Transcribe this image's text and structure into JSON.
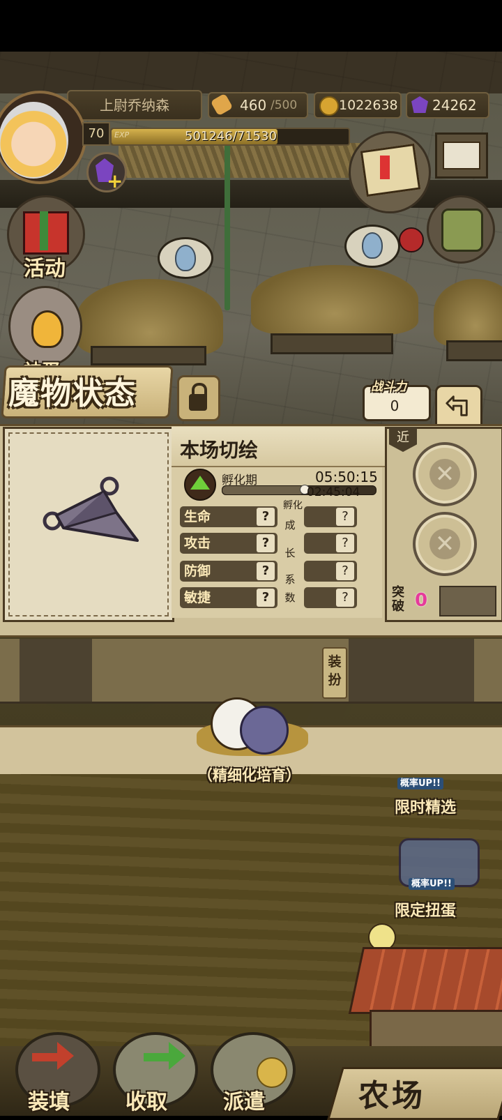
{
  "player": {
    "name": "上尉乔纳森",
    "level": "70",
    "exp_label": "EXP",
    "exp_text": "501246/71530",
    "exp_fraction": 0.7
  },
  "resources": {
    "bread": "460",
    "bread_max": "/500",
    "gold": "1022638",
    "gems": "24262"
  },
  "side_buttons": {
    "activity": "活动",
    "cut_off_label": "神蛋"
  },
  "header": {
    "title": "魔物状态",
    "power_label": "战斗力",
    "power_value": "0"
  },
  "monster": {
    "name": "本场切绘",
    "stage": "孵化期",
    "time_total": "05:50:15",
    "time_left": "02:45:04",
    "progress_fraction": 0.53,
    "growth_header": "孵化",
    "growth_chars": [
      "成",
      "长",
      "系",
      "数"
    ],
    "stats": [
      {
        "label": "生命",
        "value": "?",
        "growth": "?"
      },
      {
        "label": "攻击",
        "value": "?",
        "growth": "?"
      },
      {
        "label": "防御",
        "value": "?",
        "growth": "?"
      },
      {
        "label": "敏捷",
        "value": "?",
        "growth": "?"
      }
    ]
  },
  "equip_panel": {
    "tag": "近",
    "break_label": "突破",
    "break_value": "0"
  },
  "dress_button": "装扮",
  "training_label": "精细化培育",
  "promos": {
    "up_badge": "概率UP!!",
    "limited_select": "限时精选",
    "limited_gacha": "限定扭蛋"
  },
  "speech_dots": "•••",
  "bottom_nav": {
    "load": "装填",
    "collect": "收取",
    "dispatch": "派遣",
    "farm": "农场"
  },
  "colors": {
    "accent_gold": "#d5b24c",
    "label_cream": "#fbe9b8",
    "stage_green": "#6fcf3a",
    "break_pink": "#e63a9b"
  }
}
